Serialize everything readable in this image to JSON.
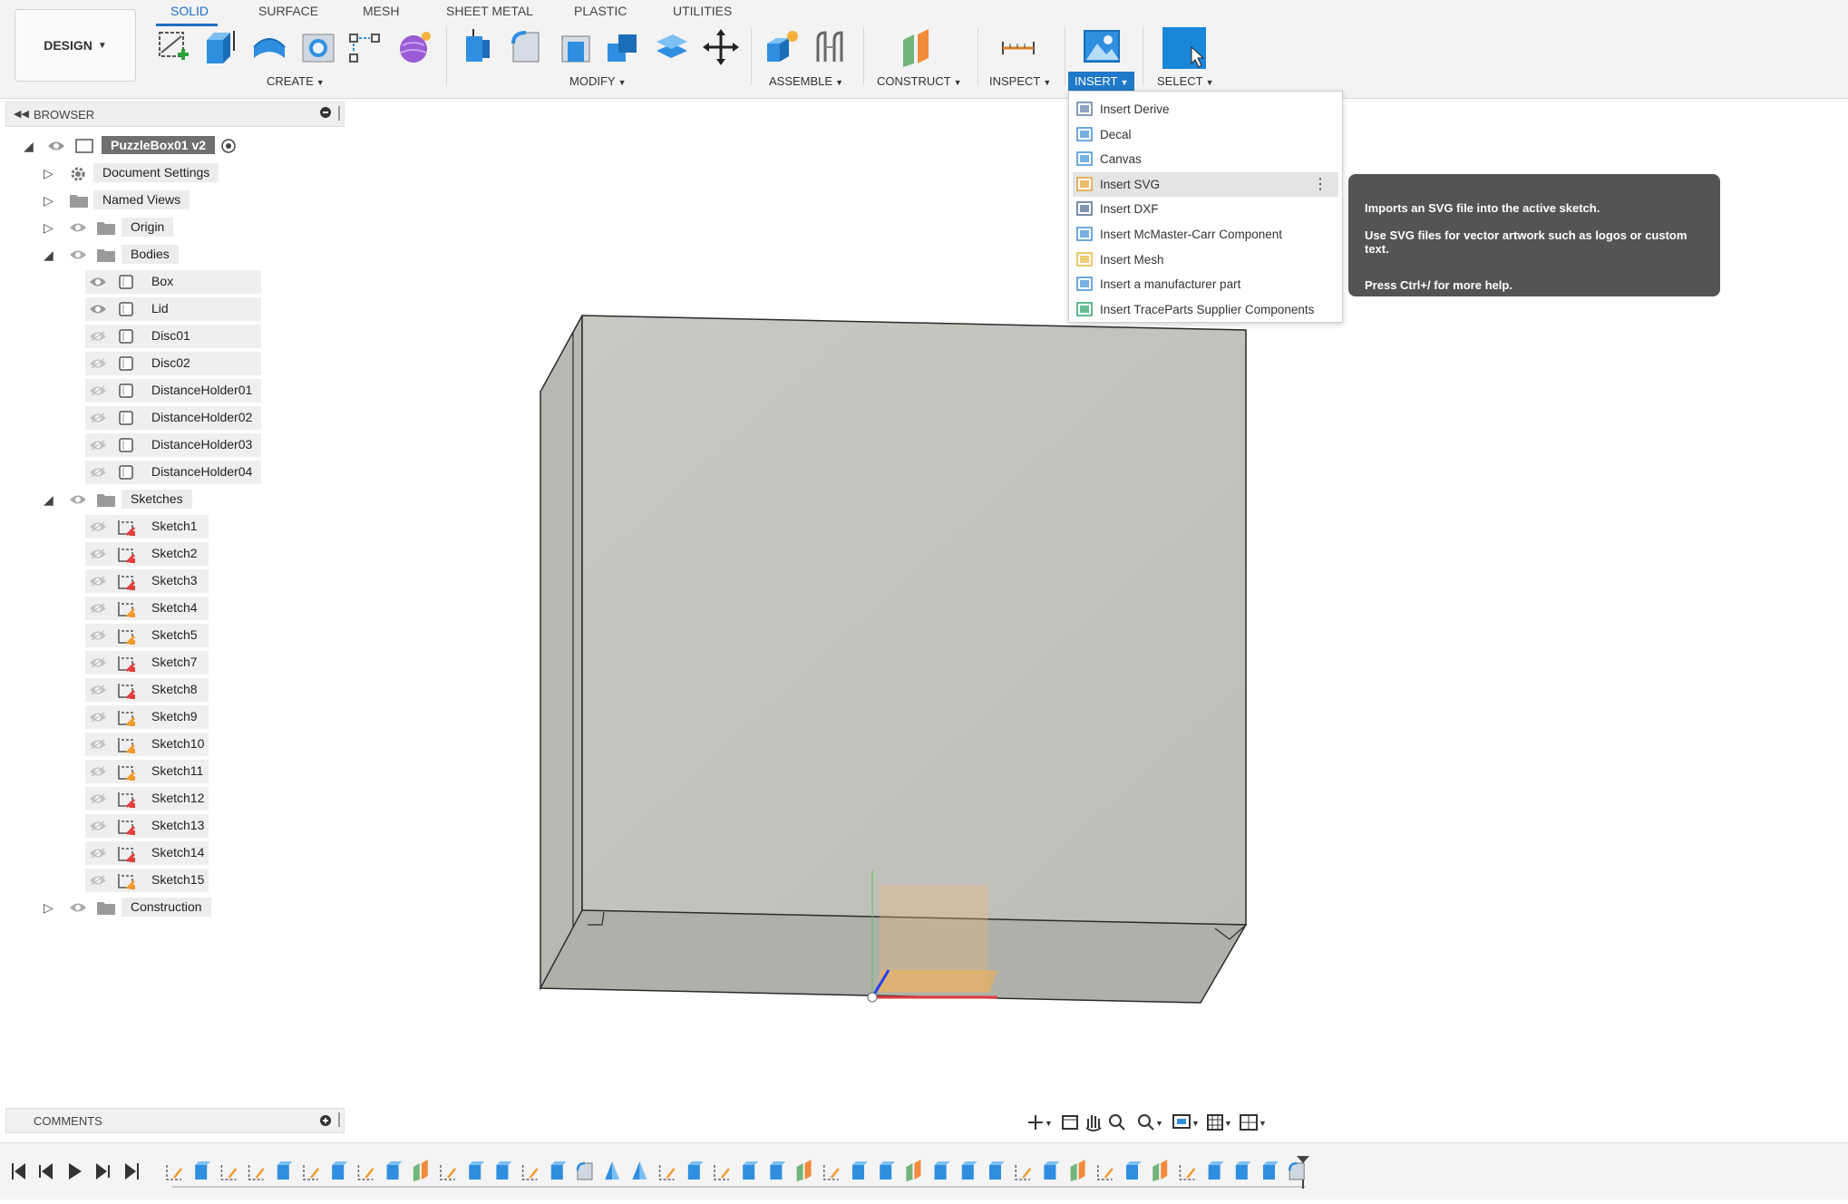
{
  "design_button": {
    "label": "DESIGN"
  },
  "tabs": [
    {
      "label": "SOLID",
      "active": true
    },
    {
      "label": "SURFACE"
    },
    {
      "label": "MESH"
    },
    {
      "label": "SHEET METAL"
    },
    {
      "label": "PLASTIC"
    },
    {
      "label": "UTILITIES"
    }
  ],
  "toolbar_groups": {
    "create": "CREATE",
    "modify": "MODIFY",
    "assemble": "ASSEMBLE",
    "construct": "CONSTRUCT",
    "inspect": "INSPECT",
    "insert": "INSERT",
    "select": "SELECT"
  },
  "browser": {
    "title": "BROWSER",
    "root": "PuzzleBox01 v2",
    "top_nodes": {
      "document_settings": "Document Settings",
      "named_views": "Named Views",
      "origin": "Origin",
      "bodies": "Bodies",
      "sketches": "Sketches",
      "construction": "Construction"
    },
    "bodies": [
      {
        "label": "Box",
        "visible": true
      },
      {
        "label": "Lid",
        "visible": true
      },
      {
        "label": "Disc01",
        "visible": false
      },
      {
        "label": "Disc02",
        "visible": false
      },
      {
        "label": "DistanceHolder01",
        "visible": false
      },
      {
        "label": "DistanceHolder02",
        "visible": false
      },
      {
        "label": "DistanceHolder03",
        "visible": false
      },
      {
        "label": "DistanceHolder04",
        "visible": false
      }
    ],
    "sketches": [
      {
        "label": "Sketch1",
        "marker": "red"
      },
      {
        "label": "Sketch2",
        "marker": "red"
      },
      {
        "label": "Sketch3",
        "marker": "red"
      },
      {
        "label": "Sketch4",
        "marker": "orange"
      },
      {
        "label": "Sketch5",
        "marker": "orange"
      },
      {
        "label": "Sketch7",
        "marker": "red"
      },
      {
        "label": "Sketch8",
        "marker": "red"
      },
      {
        "label": "Sketch9",
        "marker": "orange"
      },
      {
        "label": "Sketch10",
        "marker": "orange"
      },
      {
        "label": "Sketch11",
        "marker": "orange"
      },
      {
        "label": "Sketch12",
        "marker": "red"
      },
      {
        "label": "Sketch13",
        "marker": "red"
      },
      {
        "label": "Sketch14",
        "marker": "red"
      },
      {
        "label": "Sketch15",
        "marker": "orange"
      }
    ]
  },
  "insert_menu": {
    "items": [
      {
        "label": "Insert Derive",
        "icon": "insert-derive-icon",
        "hover": false
      },
      {
        "label": "Decal",
        "icon": "decal-icon",
        "hover": false
      },
      {
        "label": "Canvas",
        "icon": "canvas-icon",
        "hover": false
      },
      {
        "label": "Insert SVG",
        "icon": "insert-svg-icon",
        "hover": true
      },
      {
        "label": "Insert DXF",
        "icon": "insert-dxf-icon",
        "hover": false
      },
      {
        "label": "Insert McMaster-Carr Component",
        "icon": "mcmaster-icon",
        "hover": false
      },
      {
        "label": "Insert Mesh",
        "icon": "insert-mesh-icon",
        "hover": false
      },
      {
        "label": "Insert a manufacturer part",
        "icon": "manufacturer-part-icon",
        "hover": false
      },
      {
        "label": "Insert TraceParts Supplier Components",
        "icon": "traceparts-icon",
        "hover": false
      }
    ]
  },
  "tooltip": {
    "line1": "Imports an SVG file into the active sketch.",
    "line2": "Use SVG files for vector artwork such as logos or custom text.",
    "line3": "Press Ctrl+/ for more help."
  },
  "comments": {
    "title": "COMMENTS"
  },
  "colors": {
    "accent": "#1f78c8",
    "tooltip_bg": "#545454",
    "body_face": "#c4c4be",
    "body_bottom": "#aeb0aa"
  }
}
